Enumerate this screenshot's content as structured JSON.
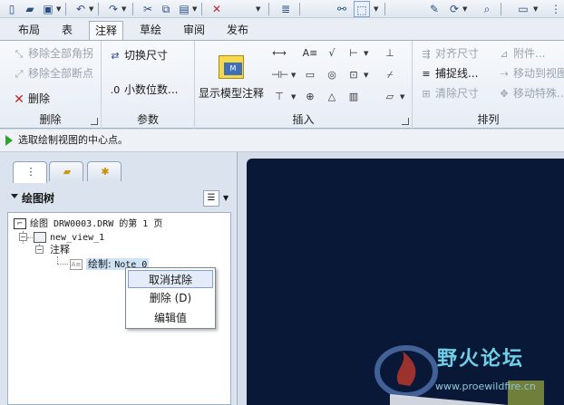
{
  "tabs": [
    {
      "label": "布局"
    },
    {
      "label": "表"
    },
    {
      "label": "注释"
    },
    {
      "label": "草绘"
    },
    {
      "label": "审阅"
    },
    {
      "label": "发布"
    }
  ],
  "ribbon": {
    "delete_group": {
      "label": "删除",
      "items": [
        {
          "label": "移除全部角拐"
        },
        {
          "label": "移除全部断点"
        },
        {
          "label": "删除"
        }
      ]
    },
    "params_group": {
      "label": "参数",
      "items": [
        {
          "label": "切换尺寸"
        },
        {
          "label": "小数位数..."
        }
      ]
    },
    "insert_group": {
      "label": "插入",
      "big_button": "显示模型注释"
    },
    "arrange_group": {
      "label": "排列",
      "items": [
        {
          "label": "对齐尺寸"
        },
        {
          "label": "附件..."
        },
        {
          "label": "捕捉线..."
        },
        {
          "label": "移动到视图"
        },
        {
          "label": "清除尺寸"
        },
        {
          "label": "移动特殊..."
        }
      ]
    }
  },
  "prompt": {
    "text": "选取绘制视图的中心点。"
  },
  "panel": {
    "title": "绘图树",
    "tree": {
      "root": "绘图 DRW0003.DRW 的第 1 页",
      "view": "new_view_1",
      "notes": "注释",
      "note_item_prefix": "绘制: ",
      "note_item_name": "Note_0"
    }
  },
  "context_menu": {
    "items": [
      {
        "label": "取消拭除"
      },
      {
        "label": "删除 (D)"
      },
      {
        "label": "编辑值"
      }
    ]
  },
  "watermark": {
    "title": "野火论坛",
    "url": "www.proewildfire.cn"
  },
  "colors": {
    "canvas": "#0a1838",
    "ribbon_bg": "#e7edf5",
    "accent": "#2fa32f",
    "menu_hover": "#e3ecf8"
  }
}
